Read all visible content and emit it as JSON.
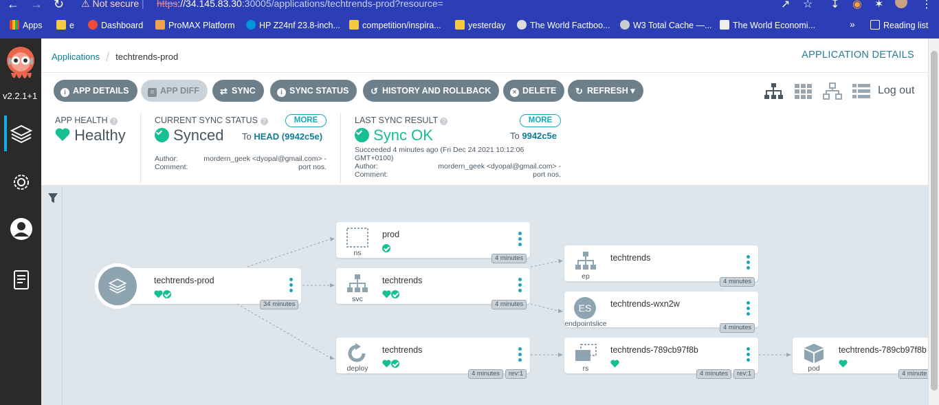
{
  "browser": {
    "security_label": "Not secure",
    "url_scheme": "https",
    "url_host": "://34.145.83.30",
    "url_rest": ":30005/applications/techtrends-prod?resource=",
    "bookmarks": [
      {
        "label": "Apps"
      },
      {
        "label": "e"
      },
      {
        "label": "Dashboard"
      },
      {
        "label": "ProMAX Platform"
      },
      {
        "label": "HP Z24nf 23.8-inch..."
      },
      {
        "label": "competition/inspira..."
      },
      {
        "label": "yesterday"
      },
      {
        "label": "The World Factboo..."
      },
      {
        "label": "W3 Total Cache —..."
      },
      {
        "label": "The World Economi..."
      }
    ],
    "bookmarks_overflow": "»",
    "reading_list": "Reading list"
  },
  "sidebar": {
    "version": "v2.2.1+1"
  },
  "breadcrumb": {
    "root": "Applications",
    "current": "techtrends-prod"
  },
  "page_title": "APPLICATION DETAILS",
  "toolbar": {
    "app_details": "APP DETAILS",
    "app_diff": "APP DIFF",
    "sync": "SYNC",
    "sync_status": "SYNC STATUS",
    "history": "HISTORY AND ROLLBACK",
    "delete": "DELETE",
    "refresh": "REFRESH",
    "logout": "Log out"
  },
  "status": {
    "health_label": "APP HEALTH",
    "health_value": "Healthy",
    "sync_label": "CURRENT SYNC STATUS",
    "sync_value": "Synced",
    "sync_more": "MORE",
    "sync_to_prefix": "To",
    "sync_to": "HEAD (9942c5e)",
    "sync_author_label": "Author:",
    "sync_author": "mordern_geek <dyopal@gmail.com> -",
    "sync_comment_label": "Comment:",
    "sync_comment": "port nos.",
    "last_label": "LAST SYNC RESULT",
    "last_value": "Sync OK",
    "last_more": "MORE",
    "last_to_prefix": "To",
    "last_to": "9942c5e",
    "last_succeeded": "Succeeded 4 minutes ago (Fri Dec 24 2021 10:12:06",
    "last_succeeded_2": "GMT+0100)",
    "last_author_label": "Author:",
    "last_author": "mordern_geek <dyopal@gmail.com> -",
    "last_comment_label": "Comment:",
    "last_comment": "port nos."
  },
  "graph": {
    "app": {
      "name": "techtrends-prod",
      "age": "34 minutes"
    },
    "nodes": [
      {
        "id": "ns",
        "name": "prod",
        "kind": "ns",
        "age": "4 minutes"
      },
      {
        "id": "svc",
        "name": "techtrends",
        "kind": "svc",
        "age": "4 minutes"
      },
      {
        "id": "deploy",
        "name": "techtrends",
        "kind": "deploy",
        "age": "4 minutes",
        "rev": "rev:1"
      },
      {
        "id": "ep",
        "name": "techtrends",
        "kind": "ep",
        "age": "4 minutes"
      },
      {
        "id": "eps",
        "name": "techtrends-wxn2w",
        "kind": "endpointslice",
        "badge": "ES",
        "age": "4 minutes"
      },
      {
        "id": "rs",
        "name": "techtrends-789cb97f8b",
        "kind": "rs",
        "age": "4 minutes",
        "rev": "rev:1"
      },
      {
        "id": "pod",
        "name": "techtrends-789cb97f8b",
        "kind": "pod",
        "age": "4 minute"
      }
    ]
  },
  "colors": {
    "accent": "#0f7c99",
    "healthy": "#18be94",
    "button": "#6d7f8b",
    "chrome": "#2b3eb5"
  }
}
